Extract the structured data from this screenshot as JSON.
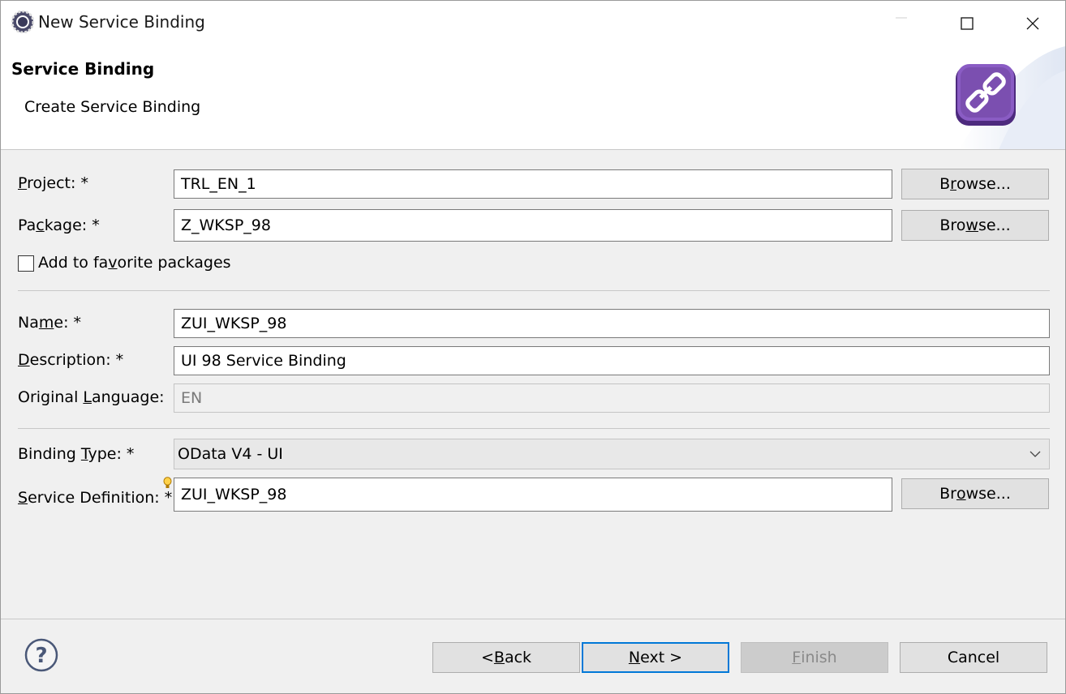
{
  "window": {
    "title": "New Service Binding",
    "app_icon": "eclipse-gear-icon",
    "minimize_icon": "minimize-icon",
    "maximize_icon": "maximize-icon",
    "close_icon": "close-icon"
  },
  "header": {
    "title": "Service Binding",
    "subtitle": "Create Service Binding",
    "icon": "chain-link-icon",
    "icon_color": "#7b4fb0"
  },
  "form": {
    "project": {
      "label_pre": "",
      "label_key": "P",
      "label_post": "roject: *",
      "value": "TRL_EN_1",
      "browse": {
        "pre": "B",
        "key": "r",
        "post": "owse..."
      }
    },
    "package": {
      "label_pre": "Pa",
      "label_key": "c",
      "label_post": "kage: *",
      "value": "Z_WKSP_98",
      "browse": {
        "pre": "Bro",
        "key": "w",
        "post": "se..."
      }
    },
    "favorite": {
      "label_pre": "Add to fa",
      "label_key": "v",
      "label_post": "orite packages",
      "checked": false
    },
    "name": {
      "label_pre": "Na",
      "label_key": "m",
      "label_post": "e: *",
      "value": "ZUI_WKSP_98"
    },
    "description": {
      "label_pre": "",
      "label_key": "D",
      "label_post": "escription: *",
      "value": "UI 98 Service Binding"
    },
    "original_language": {
      "label_pre": "Original ",
      "label_key": "L",
      "label_post": "anguage:",
      "value": "EN"
    },
    "binding_type": {
      "label_pre": "Binding ",
      "label_key": "T",
      "label_post": "ype: *",
      "value": "OData V4 - UI"
    },
    "service_definition": {
      "label_pre": "",
      "label_key": "S",
      "label_post": "ervice Definition: *",
      "value": "ZUI_WKSP_98",
      "browse": {
        "pre": "Br",
        "key": "o",
        "post": "wse..."
      }
    }
  },
  "footer": {
    "help_icon": "help-icon",
    "back": {
      "pre": "< ",
      "key": "B",
      "post": "ack"
    },
    "next": {
      "pre": "",
      "key": "N",
      "post": "ext >"
    },
    "finish": {
      "pre": "",
      "key": "F",
      "post": "inish"
    },
    "cancel": "Cancel"
  }
}
